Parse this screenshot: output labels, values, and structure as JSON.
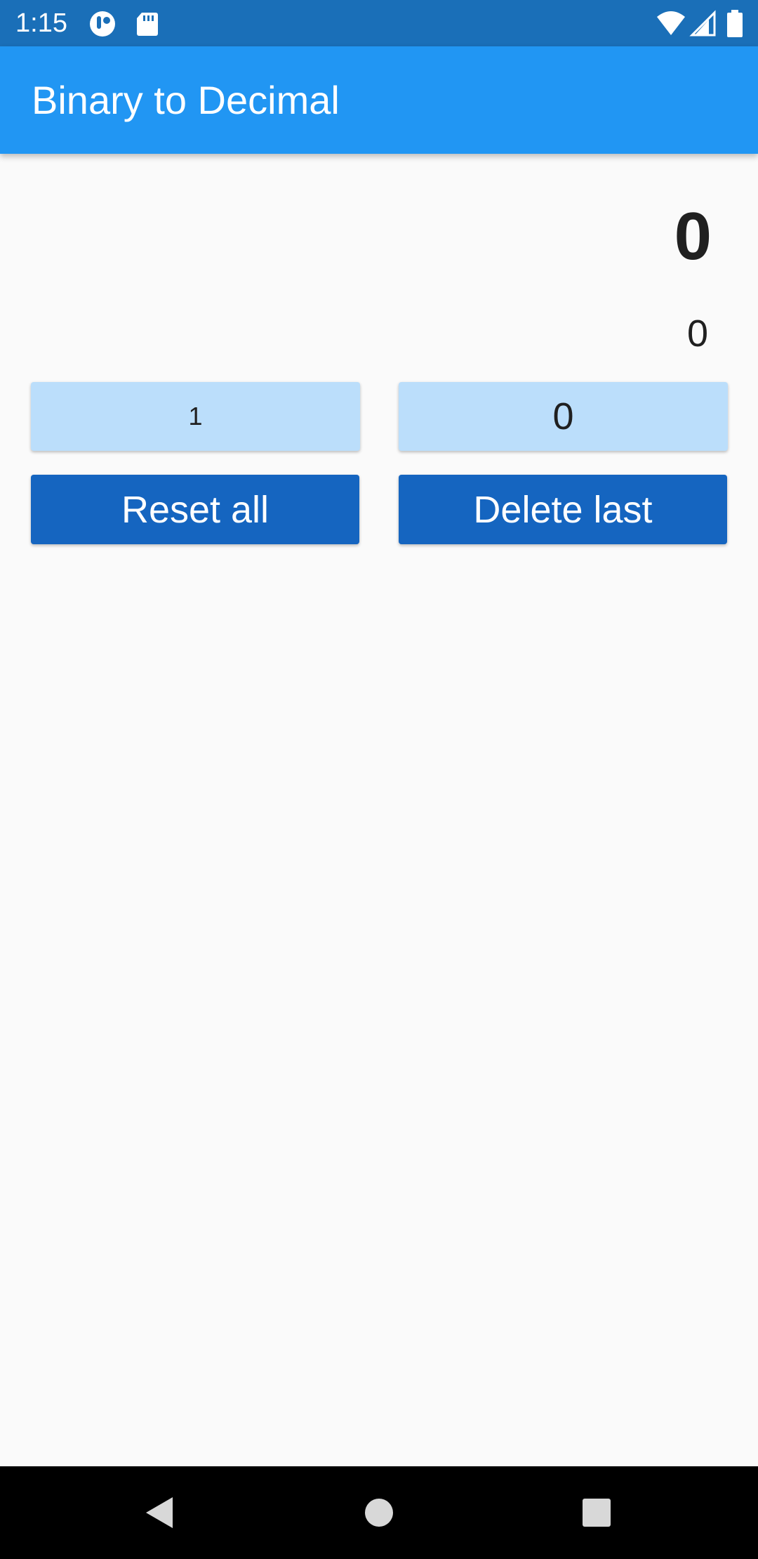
{
  "status_bar": {
    "time": "1:15",
    "left_icons": [
      "app-notification-icon",
      "sd-card-icon"
    ],
    "right_icons": [
      "wifi-icon",
      "cell-signal-icon",
      "battery-icon"
    ]
  },
  "app_bar": {
    "title": "Binary to Decimal",
    "color": "#2196f3"
  },
  "display": {
    "decimal_value": "0",
    "binary_value": "0"
  },
  "keypad": {
    "one_label": "1",
    "zero_label": "0",
    "reset_label": "Reset all",
    "delete_label": "Delete last",
    "digit_button_color": "#bbdefb",
    "action_button_color": "#1565c0"
  },
  "nav_bar": {
    "icons": [
      "back-icon",
      "home-icon",
      "recents-icon"
    ]
  }
}
